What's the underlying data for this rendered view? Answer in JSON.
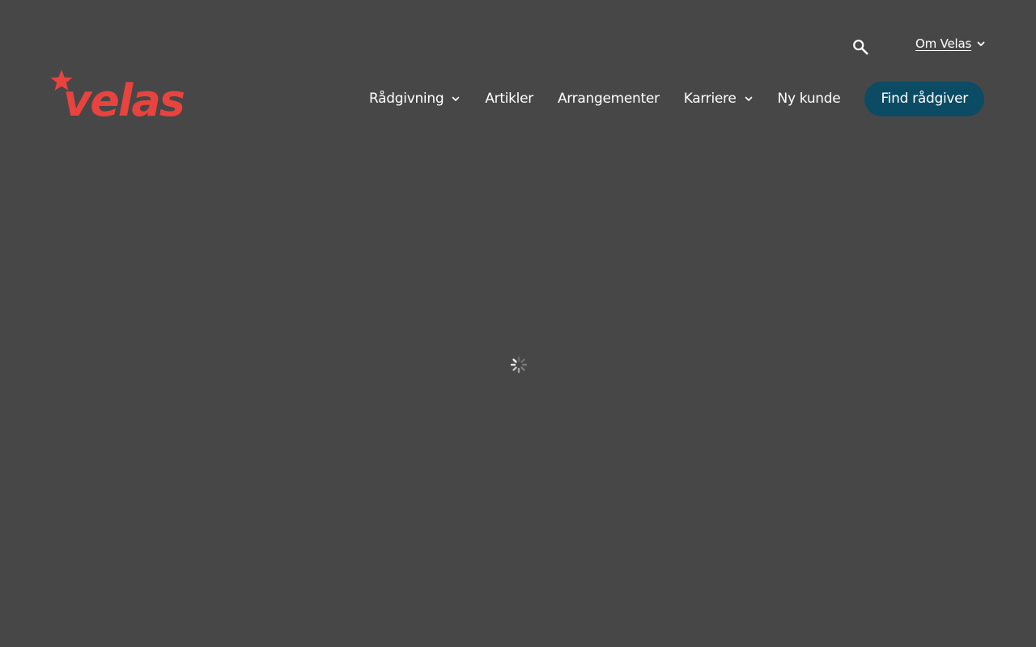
{
  "header": {
    "logo_text": "velas",
    "utility": {
      "search_icon": "search-icon",
      "om_velas_label": "Om Velas"
    },
    "nav": [
      {
        "label": "Rådgivning",
        "has_dropdown": true
      },
      {
        "label": "Artikler",
        "has_dropdown": false
      },
      {
        "label": "Arrangementer",
        "has_dropdown": false
      },
      {
        "label": "Karriere",
        "has_dropdown": true
      },
      {
        "label": "Ny kunde",
        "has_dropdown": false
      }
    ],
    "cta_label": "Find rådgiver"
  },
  "main": {
    "loading_icon": "spinner-icon"
  },
  "colors": {
    "background": "#474747",
    "brand_red": "#e8433e",
    "cta_background": "#0b4b63",
    "text": "#ffffff"
  }
}
